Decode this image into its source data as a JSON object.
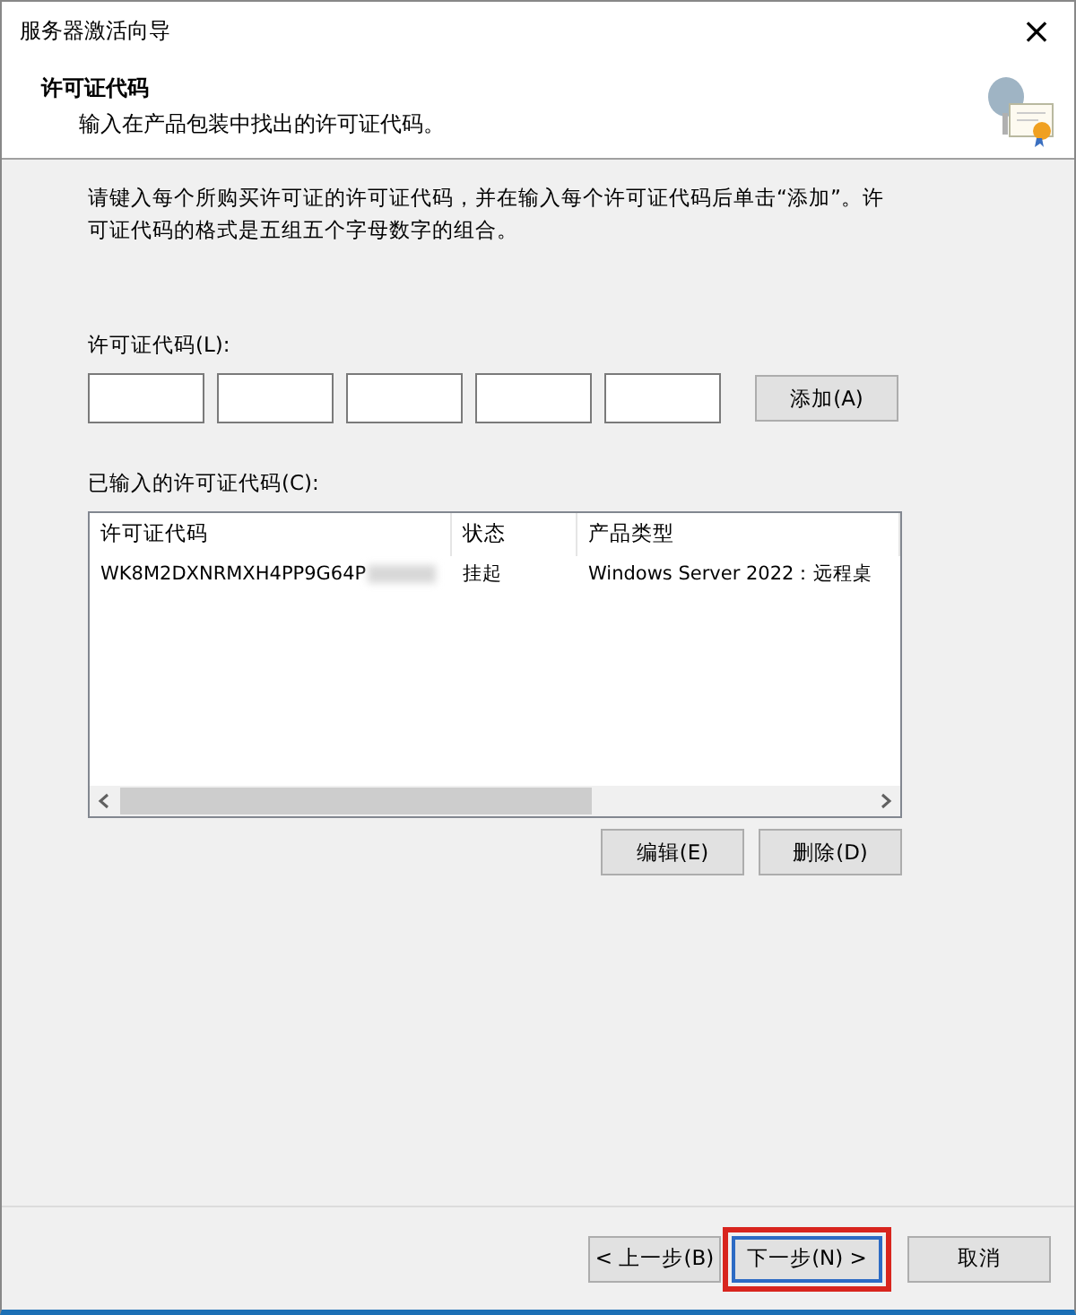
{
  "window": {
    "title": "服务器激活向导",
    "close": "×"
  },
  "header": {
    "title": "许可证代码",
    "subtitle": "输入在产品包装中找出的许可证代码。"
  },
  "instructions": "请键入每个所购买许可证的许可证代码，并在输入每个许可证代码后单击“添加”。许可证代码的格式是五组五个字母数字的组合。",
  "code_label": "许可证代码(L):",
  "code_fields": [
    {
      "kind": "input"
    },
    {
      "kind": "input"
    },
    {
      "kind": "input"
    },
    {
      "kind": "input"
    },
    {
      "kind": "input"
    }
  ],
  "add_button": "添加(A)",
  "list_label": "已输入的许可证代码(C):",
  "table": {
    "columns": [
      "许可证代码",
      "状态",
      "产品类型"
    ],
    "rows": [
      {
        "cells": [
          "WK8M2DXNRMXH4PP9G64P",
          "挂起",
          "Windows Server 2022：远程桌"
        ],
        "redacted": true
      }
    ]
  },
  "list_buttons": [
    "编辑(E)",
    "删除(D)"
  ],
  "footer_buttons": [
    {
      "label": "< 上一步(B)",
      "default": false,
      "highlighted": false
    },
    {
      "label": "下一步(N) >",
      "default": true,
      "highlighted": true
    },
    {
      "label": "取消",
      "default": false,
      "highlighted": false
    }
  ]
}
